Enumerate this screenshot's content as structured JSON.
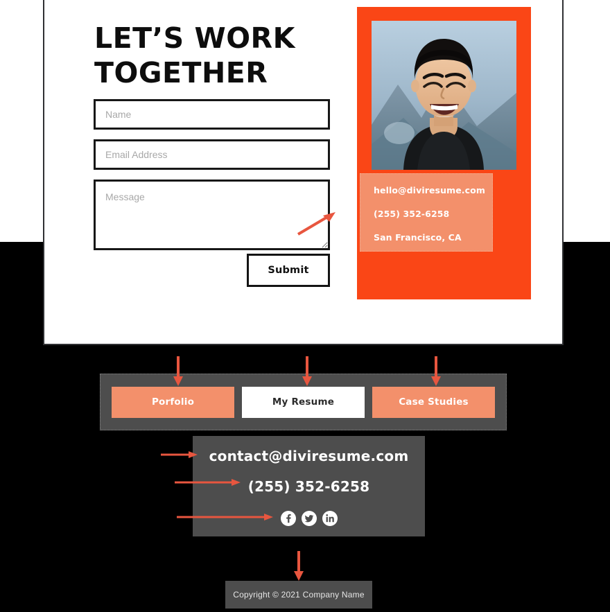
{
  "colors": {
    "orange": "#fa4616",
    "salmon": "#f3906b",
    "gray_panel": "#4d4d4d",
    "black_bg": "#000000",
    "white": "#ffffff",
    "arrow": "#e8563f"
  },
  "hero": {
    "title": "LET’S WORK TOGETHER"
  },
  "form": {
    "name_placeholder": "Name",
    "name_value": "",
    "email_placeholder": "Email Address",
    "email_value": "",
    "message_placeholder": "Message",
    "message_value": "",
    "submit_label": "Submit"
  },
  "profile": {
    "photo_alt": "portrait-photo",
    "contact": {
      "email": "hello@diviresume.com",
      "phone": "(255) 352-6258",
      "location": "San Francisco, CA"
    }
  },
  "nav": {
    "buttons": [
      {
        "label": "Porfolio",
        "style": "accent"
      },
      {
        "label": "My Resume",
        "style": "light"
      },
      {
        "label": "Case Studies",
        "style": "accent"
      }
    ]
  },
  "footer": {
    "email": "contact@diviresume.com",
    "phone": "(255) 352-6258",
    "social": [
      {
        "name": "facebook-icon",
        "glyph": "f"
      },
      {
        "name": "twitter-icon",
        "glyph": "t"
      },
      {
        "name": "linkedin-icon",
        "glyph": "in"
      }
    ]
  },
  "copyright": {
    "text": "Copyright © 2021 Company Name"
  }
}
